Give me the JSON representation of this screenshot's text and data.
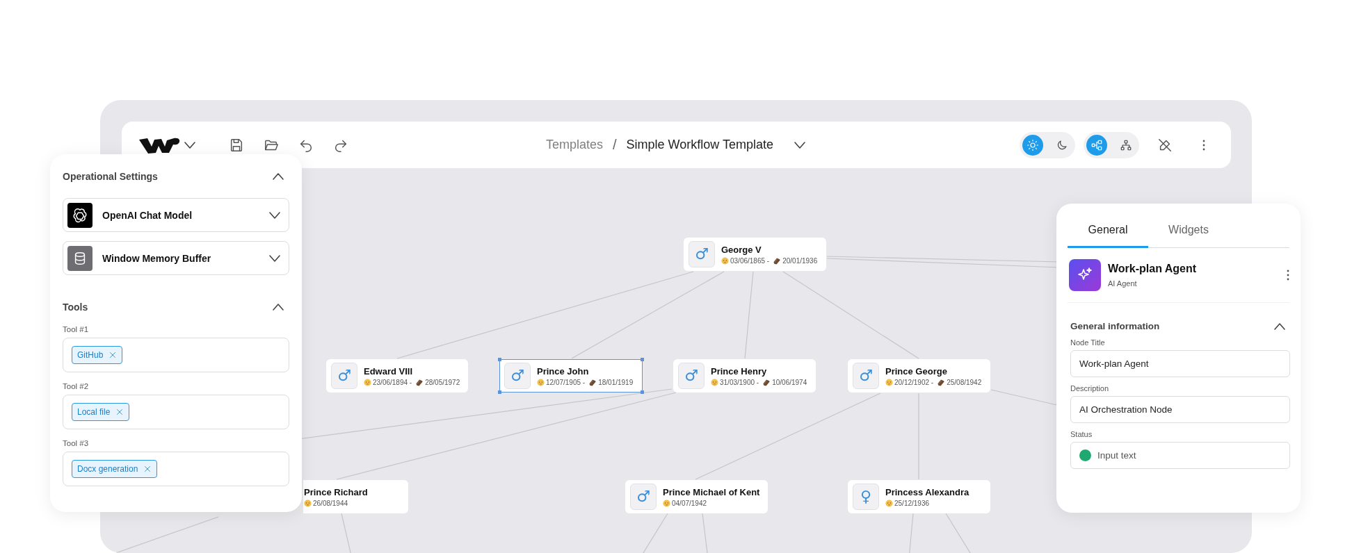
{
  "toolbar": {
    "breadcrumb": [
      {
        "label": "Templates",
        "current": false
      },
      {
        "label": "Simple Workflow Template",
        "current": true
      }
    ],
    "separator": "/",
    "theme_toggle": [
      {
        "kind": "sun",
        "selected": true
      },
      {
        "kind": "moon",
        "selected": false
      }
    ],
    "layout_toggle": [
      {
        "kind": "graph",
        "selected": true
      },
      {
        "kind": "tree",
        "selected": false
      }
    ]
  },
  "canvas": {
    "nodes": [
      {
        "name": "George V",
        "symbol": "♂",
        "born": "03/06/1865 -",
        "died": "20/01/1936",
        "selected": false
      },
      {
        "name": "Edward VIII",
        "symbol": "♂",
        "born": "23/06/1894 -",
        "died": "28/05/1972",
        "selected": false
      },
      {
        "name": "Prince John",
        "symbol": "♂",
        "born": "12/07/1905 -",
        "died": "18/01/1919",
        "selected": true
      },
      {
        "name": "Prince Henry",
        "symbol": "♂",
        "born": "31/03/1900 -",
        "died": "10/06/1974",
        "selected": false
      },
      {
        "name": "Prince George",
        "symbol": "♂",
        "born": "20/12/1902 -",
        "died": "25/08/1942",
        "selected": false
      },
      {
        "name": "Prince Richard",
        "born": "26/08/1944",
        "selected": false
      },
      {
        "name": "Prince Michael of Kent",
        "symbol": "♂",
        "born": "04/07/1942",
        "selected": false
      },
      {
        "name": "Princess Alexandra",
        "symbol": "♀",
        "born": "25/12/1936",
        "selected": false
      }
    ]
  },
  "left_panel": {
    "sections": [
      {
        "kind": "models",
        "title": "Operational Settings",
        "expanded": true,
        "items": [
          {
            "kind": "openai",
            "label": "OpenAI Chat Model",
            "expanded": false
          },
          {
            "kind": "memory",
            "label": "Window Memory Buffer",
            "expanded": false
          }
        ]
      },
      {
        "kind": "tools",
        "title": "Tools",
        "expanded": true,
        "fields": [
          {
            "label": "Tool #1",
            "chips": [
              "GitHub"
            ]
          },
          {
            "label": "Tool #2",
            "chips": [
              "Local file"
            ]
          },
          {
            "label": "Tool #3",
            "chips": [
              "Docx generation"
            ]
          }
        ]
      }
    ]
  },
  "right_panel": {
    "tabs": [
      {
        "label": "General",
        "selected": true
      },
      {
        "label": "Widgets",
        "selected": false
      }
    ],
    "agent": {
      "title": "Work-plan Agent",
      "subtitle": "AI Agent"
    },
    "section": {
      "title": "General information",
      "expanded": true
    },
    "fields": [
      {
        "label": "Node Title",
        "value": "Work-plan Agent"
      },
      {
        "label": "Description",
        "value": "AI Orchestration Node"
      },
      {
        "label": "Status",
        "placeholder": "Input text",
        "color": "#1fa971"
      }
    ]
  }
}
